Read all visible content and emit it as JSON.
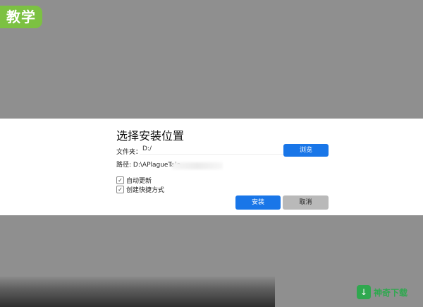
{
  "corner_badge": "教学",
  "dialog": {
    "title": "选择安装位置",
    "folder_label": "文件夹：",
    "folder_value": "D:/",
    "browse_label": "浏览",
    "path_label": "路径:",
    "path_value": "D:\\APlagueTale",
    "checkboxes": [
      {
        "label": "自动更新",
        "checked": true
      },
      {
        "label": "创建快捷方式",
        "checked": true
      }
    ],
    "install_label": "安装",
    "cancel_label": "取消"
  },
  "watermark": {
    "text": "神奇下载",
    "icon": "download-logo-icon"
  },
  "colors": {
    "background": "#8f8f8f",
    "badge": "#7cc142",
    "primary_button": "#1976e8",
    "secondary_button": "#b9b9b9"
  }
}
